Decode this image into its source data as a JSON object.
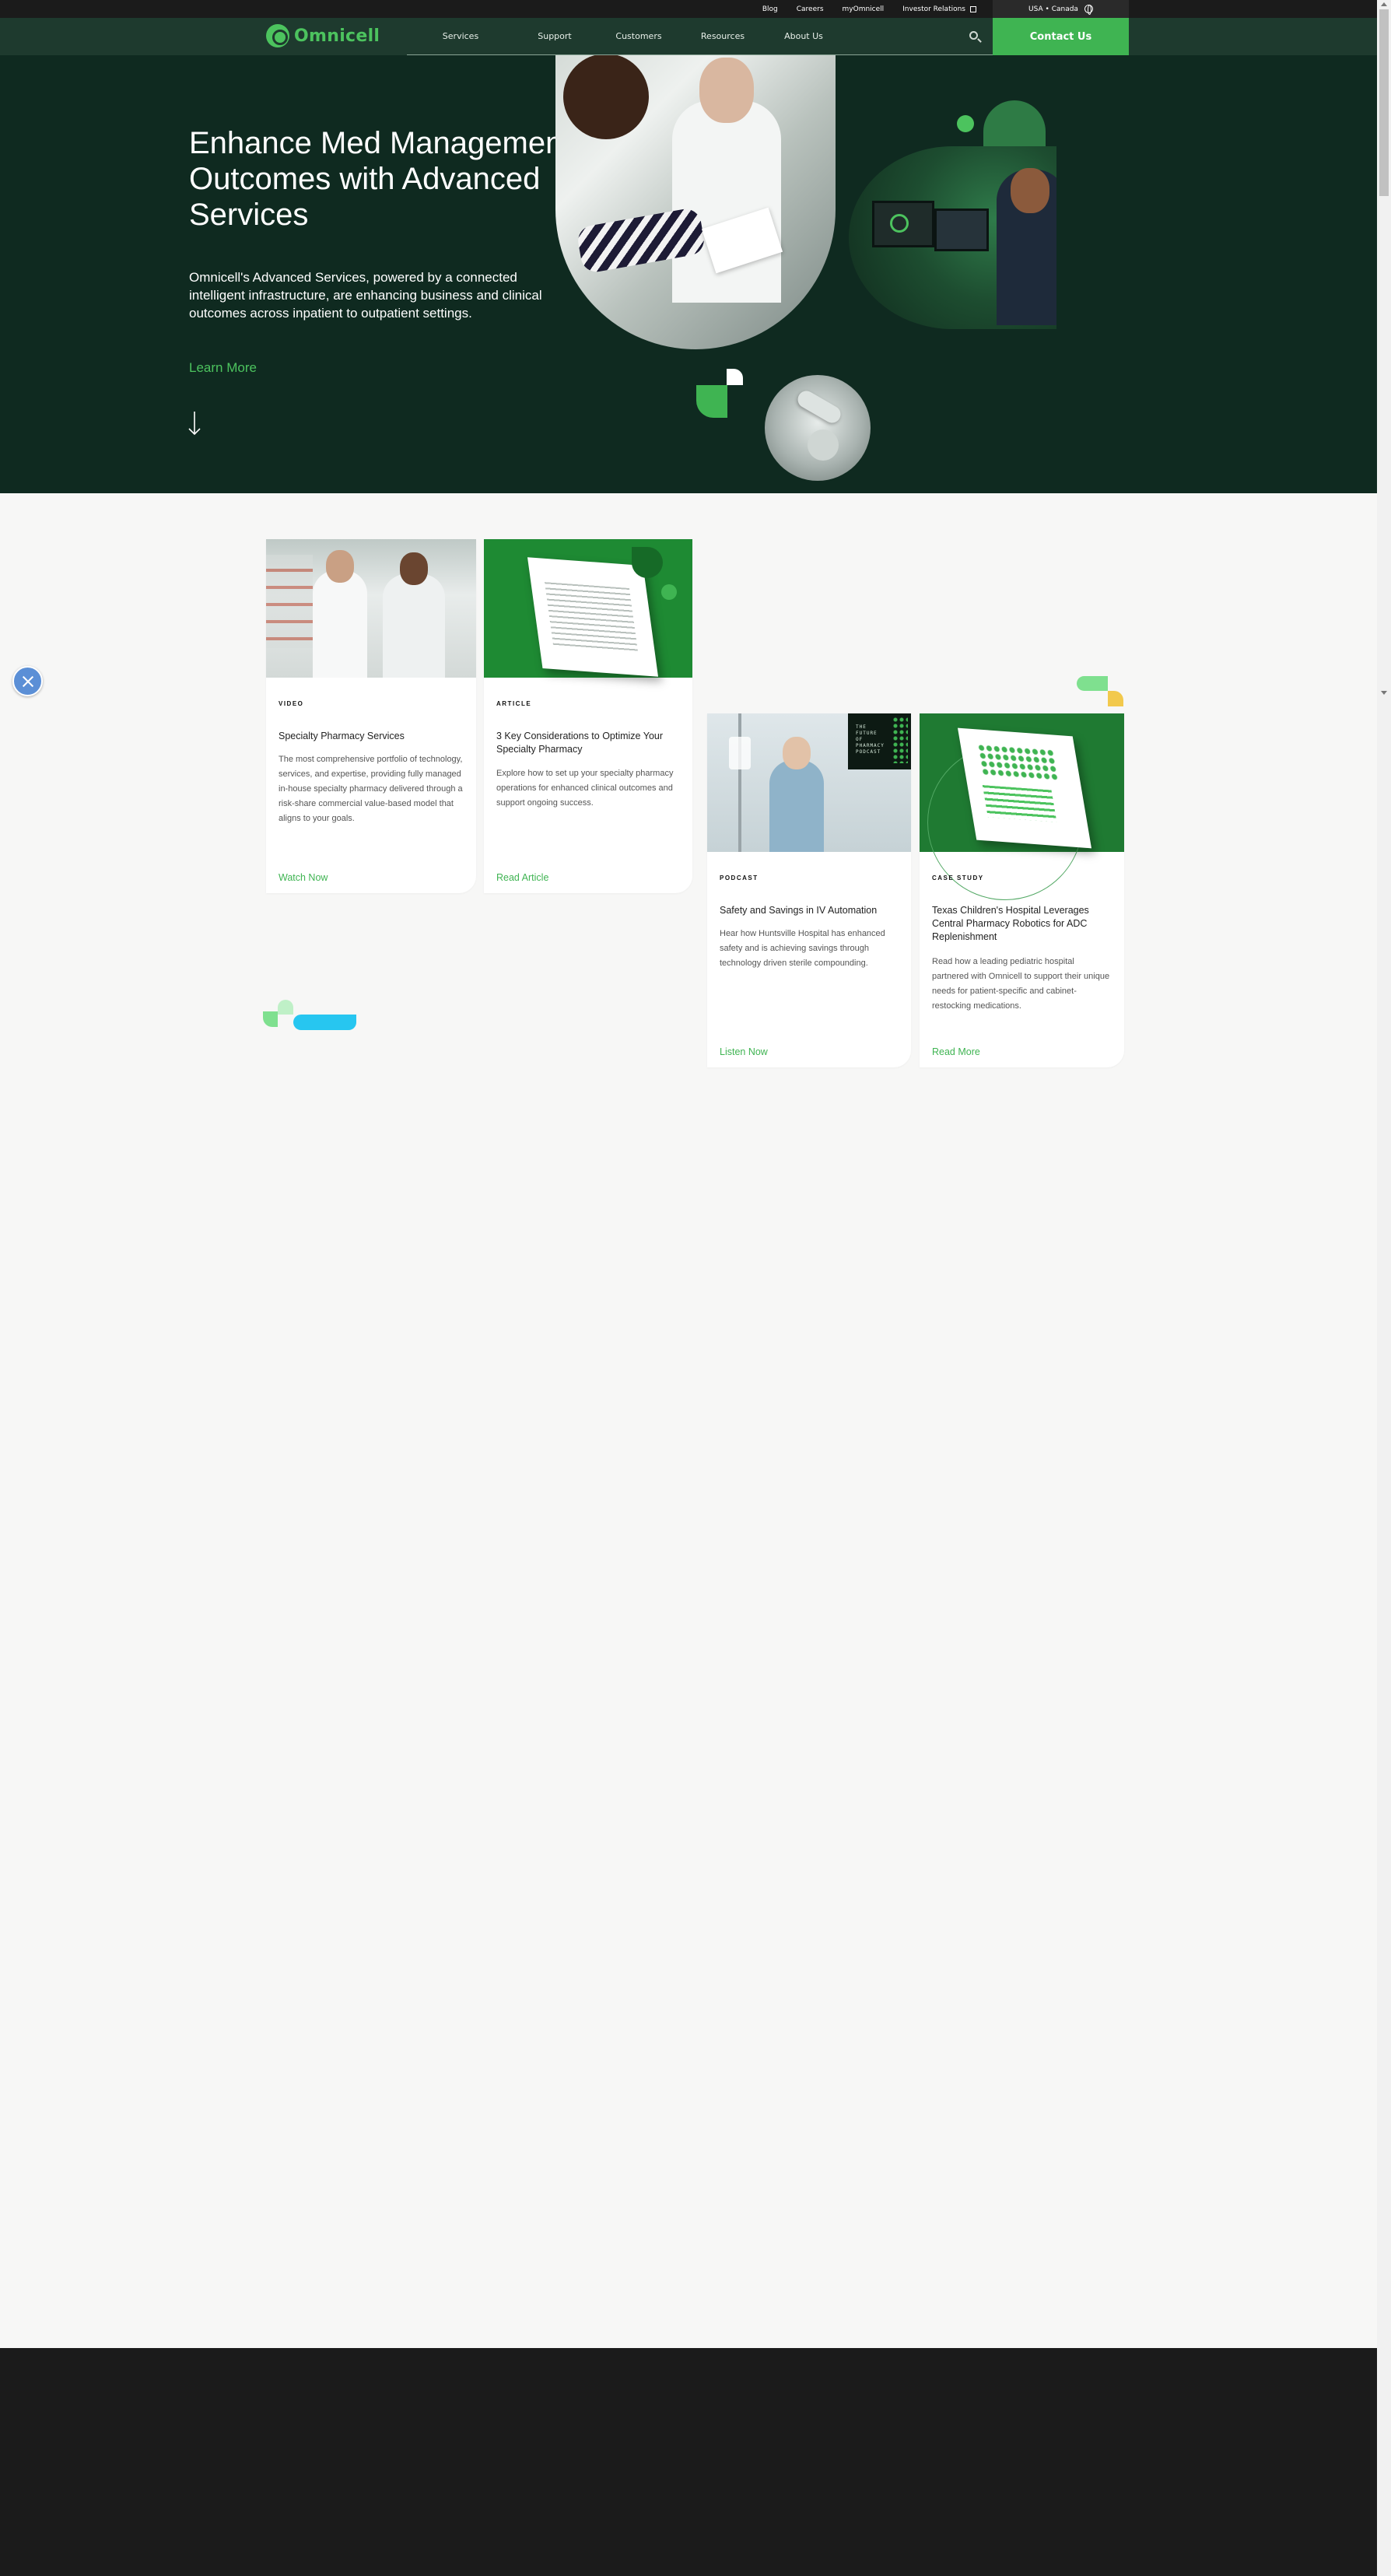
{
  "utility_bar": {
    "links": [
      "Blog",
      "Careers",
      "myOmnicell",
      "Investor Relations"
    ],
    "region": "USA • Canada"
  },
  "nav": {
    "logo_text": "Omnicell",
    "items": [
      "Services",
      "Support",
      "Customers",
      "Resources",
      "About Us"
    ],
    "contact_label": "Contact Us"
  },
  "hero": {
    "title": "Enhance Med Management Outcomes with Advanced Services",
    "description": "Omnicell's Advanced Services, powered by a connected intelligent infrastructure, are enhancing business and clinical outcomes across inpatient to outpatient settings.",
    "cta": "Learn More"
  },
  "cards": [
    {
      "type": "VIDEO",
      "title": "Specialty Pharmacy Services",
      "description": "The most comprehensive portfolio of technology, services, and expertise, providing fully managed in-house specialty pharmacy delivered through a risk-share commercial value-based model that aligns to your goals.",
      "link": "Watch Now"
    },
    {
      "type": "ARTICLE",
      "title": "3 Key Considerations to Optimize Your Specialty Pharmacy",
      "description": "Explore how to set up your specialty pharmacy operations for enhanced clinical outcomes and support ongoing success.",
      "link": "Read Article"
    },
    {
      "type": "PODCAST",
      "title": "Safety and Savings in IV Automation",
      "description": "Hear how Huntsville Hospital has enhanced safety and is achieving savings through technology driven sterile compounding.",
      "link": "Listen Now",
      "cover_text": "THE FUTURE OF PHARMACY PODCAST"
    },
    {
      "type": "CASE STUDY",
      "title": "Texas Children's Hospital Leverages Central Pharmacy Robotics for ADC Replenishment",
      "description": "Read how a leading pediatric hospital partnered with Omnicell to support their unique needs for patient-specific and cabinet-restocking medications.",
      "link": "Read More"
    }
  ],
  "colors": {
    "brand_green": "#3fb452",
    "hero_bg": "#0f2a20",
    "nav_bg": "#1e3a2e",
    "close_button": "#5b8fd6"
  },
  "icons": [
    "external-link-icon",
    "globe-icon",
    "search-icon",
    "down-arrow-icon",
    "close-icon"
  ]
}
